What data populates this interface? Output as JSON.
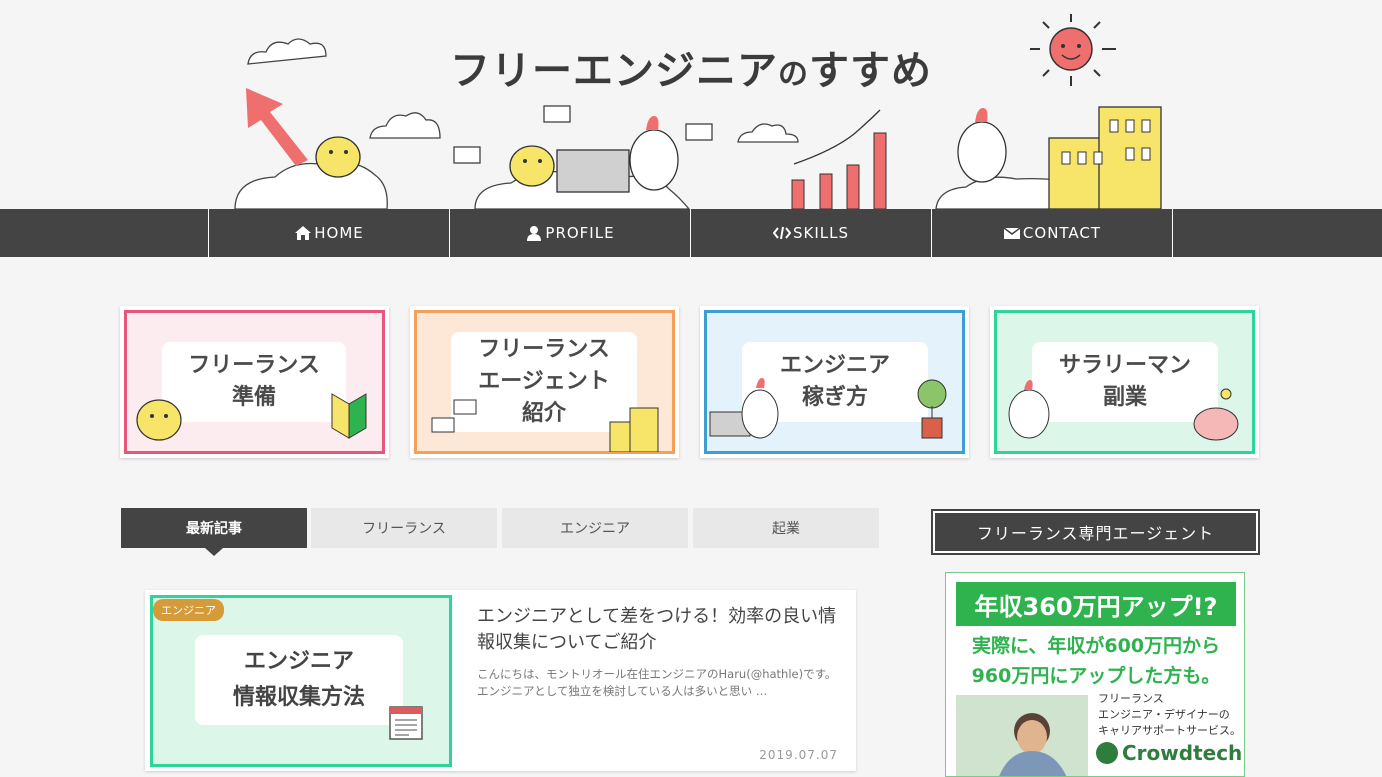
{
  "site": {
    "title_main": "フリーエンジニア",
    "title_no": "の",
    "title_end": "すすめ"
  },
  "nav": [
    {
      "label": "HOME",
      "icon": "home-icon"
    },
    {
      "label": "PROFILE",
      "icon": "user-icon"
    },
    {
      "label": "SKILLS",
      "icon": "code-icon"
    },
    {
      "label": "CONTACT",
      "icon": "envelope-icon"
    }
  ],
  "categories": [
    {
      "line1": "フリーランス",
      "line2": "準備",
      "line3": "",
      "color": "#e8567c",
      "bg": "#fdecef"
    },
    {
      "line1": "フリーランス",
      "line2": "エージェント",
      "line3": "紹介",
      "color": "#f5a05a",
      "bg": "#fde8d8"
    },
    {
      "line1": "エンジニア",
      "line2": "稼ぎ方",
      "line3": "",
      "color": "#3d9fd1",
      "bg": "#e4f3fb"
    },
    {
      "line1": "サラリーマン",
      "line2": "副業",
      "line3": "",
      "color": "#2fd49a",
      "bg": "#dcf7ea"
    }
  ],
  "tabs": [
    {
      "label": "最新記事",
      "active": true
    },
    {
      "label": "フリーランス",
      "active": false
    },
    {
      "label": "エンジニア",
      "active": false
    },
    {
      "label": "起業",
      "active": false
    }
  ],
  "article": {
    "badge": "エンジニア",
    "thumb_line1": "エンジニア",
    "thumb_line2": "情報収集方法",
    "title": "エンジニアとして差をつける！効率の良い情報収集についてご紹介",
    "excerpt": "こんにちは、モントリオール在住エンジニアのHaru(@hathle)です。 エンジニアとして独立を検討している人は多いと思い …",
    "date": "2019.07.07"
  },
  "sidebar": {
    "heading": "フリーランス専門エージェント",
    "ad": {
      "headline": "年収360万円アップ!?",
      "sub1": "実際に、年収が600万円から",
      "sub2": "960万円にアップした方も。",
      "text1": "フリーランス",
      "text2": "エンジニア・デザイナーの",
      "text3": "キャリアサポートサービス。",
      "brand": "Crowdtech"
    }
  }
}
